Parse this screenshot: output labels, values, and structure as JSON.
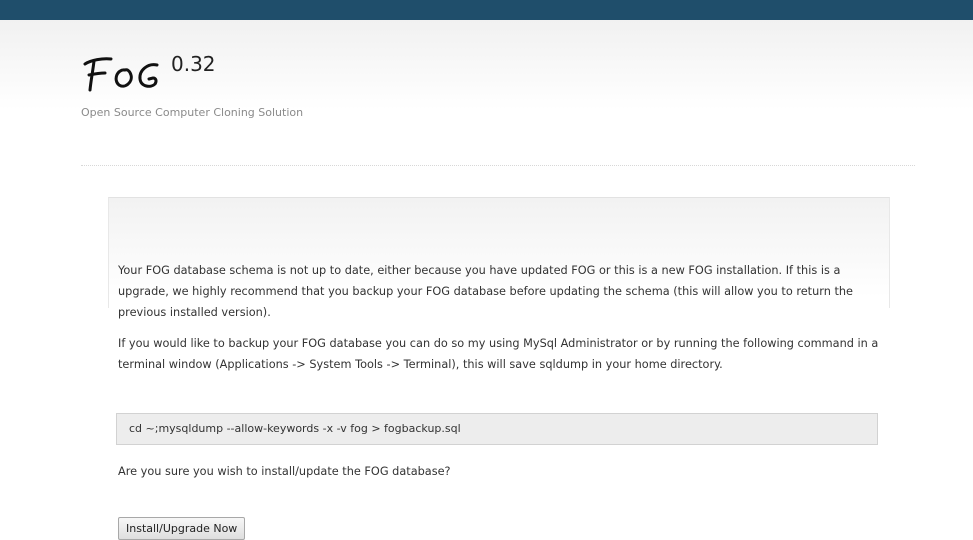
{
  "header": {
    "logo_text": "FOG",
    "version": "0.32",
    "subtitle": "Open Source Computer Cloning Solution"
  },
  "colors": {
    "topbar": "#1f4e6b"
  },
  "main": {
    "paragraph1": "Your FOG database schema is not up to date, either because you have updated FOG or this is a new FOG installation. If this is a upgrade, we highly recommend that you backup your FOG database before updating the schema (this will allow you to return the previous installed version).",
    "paragraph2": "If you would like to backup your FOG database you can do so my using MySql Administrator or by running the following command in a terminal window (Applications -> System Tools -> Terminal), this will save sqldump in your home directory.",
    "command": "cd ~;mysqldump --allow-keywords -x -v fog > fogbackup.sql",
    "question": "Are you sure you wish to install/update the FOG database?",
    "install_button": "Install/Upgrade Now"
  }
}
